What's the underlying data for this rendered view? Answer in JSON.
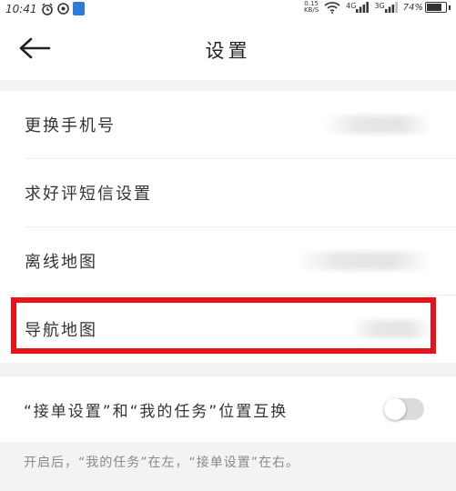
{
  "status_bar": {
    "time": "10:41",
    "network_speed_value": "0.15",
    "network_speed_unit": "KB/S",
    "signal_1": "4G",
    "signal_2": "3G",
    "battery": "74%"
  },
  "header": {
    "title": "设置",
    "back_icon": "arrow-left-icon"
  },
  "menu": {
    "items": [
      {
        "label": "更换手机号"
      },
      {
        "label": "求好评短信设置"
      },
      {
        "label": "离线地图"
      },
      {
        "label": "导航地图"
      }
    ]
  },
  "swap_setting": {
    "label": "“接单设置”和“我的任务”位置互换",
    "enabled": false,
    "hint": "开启后，“我的任务”在左，“接单设置”在右。"
  },
  "colors": {
    "highlight": "#e8121b",
    "background_gray": "#f3f3f3",
    "toggle_off": "#dcdcdc"
  }
}
